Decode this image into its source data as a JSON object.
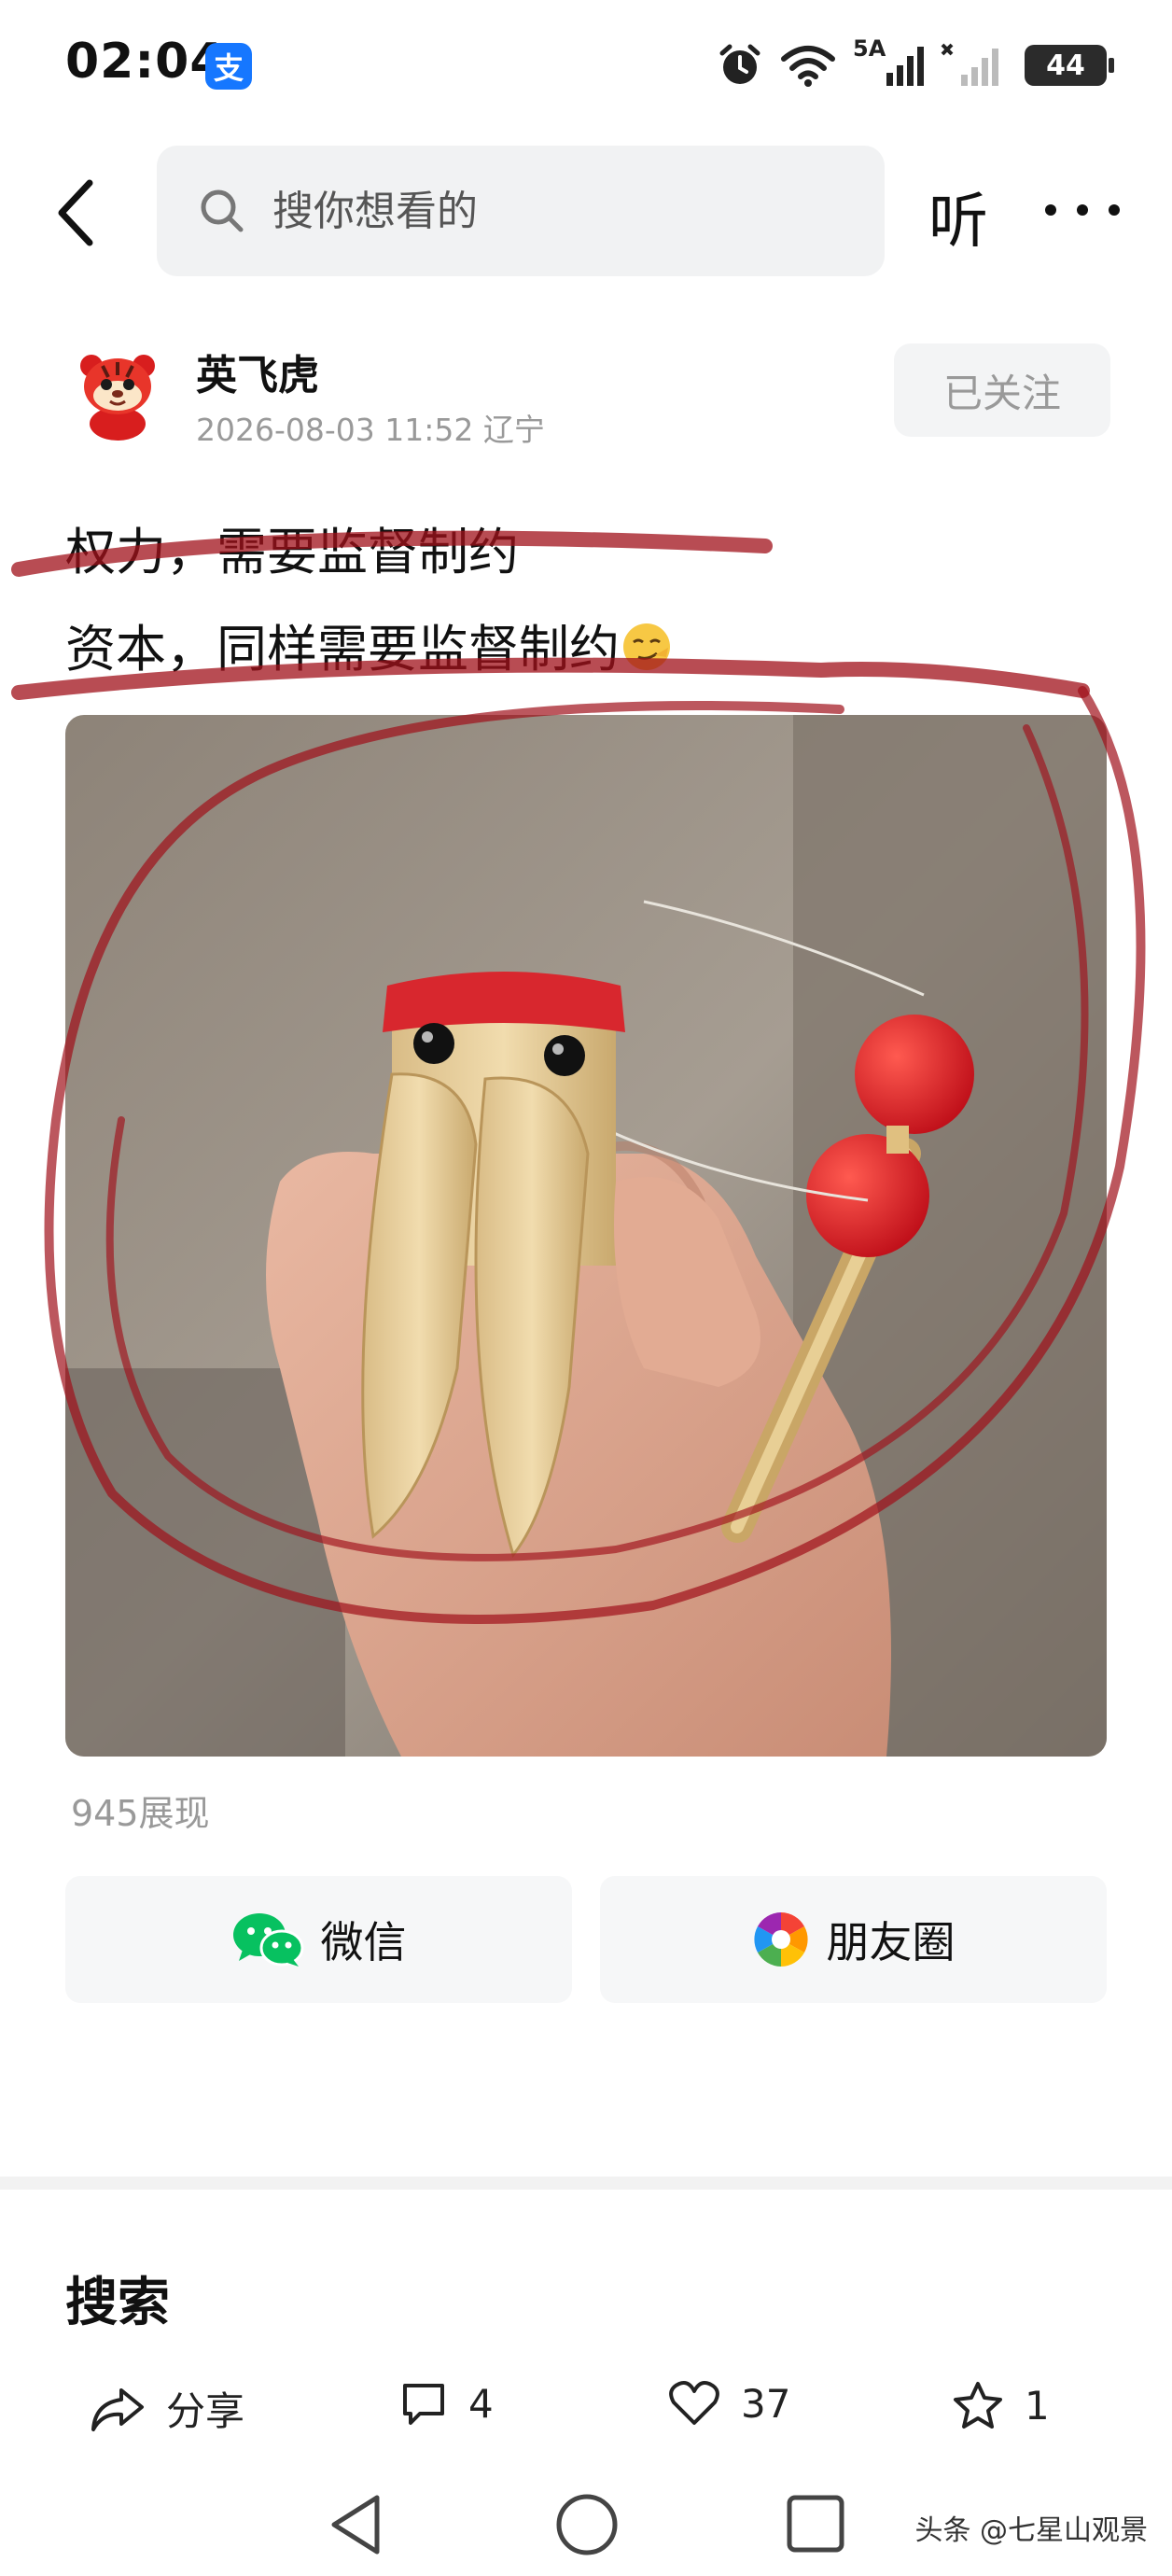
{
  "status_bar": {
    "time": "02:04",
    "app_badge": "支",
    "network": "5A",
    "battery": "44"
  },
  "header": {
    "search_placeholder": "搜你想看的",
    "listen_label": "听"
  },
  "author": {
    "name": "英飞虎",
    "meta": "2026-08-03 11:52 辽宁",
    "follow_label": "已关注"
  },
  "post": {
    "line1": "权力，需要监督制约",
    "line2": "资本，同样需要监督制约"
  },
  "stats": {
    "views": "945展现"
  },
  "share": {
    "wechat_label": "微信",
    "moments_label": "朋友圈"
  },
  "section": {
    "title": "搜索"
  },
  "actions": {
    "share_label": "分享",
    "comments": "4",
    "likes": "37",
    "favorites": "1"
  },
  "watermark": "头条 @七星山观景",
  "colors": {
    "accent_red": "#b4202a",
    "wechat_green": "#07c160",
    "muted": "#999999"
  }
}
